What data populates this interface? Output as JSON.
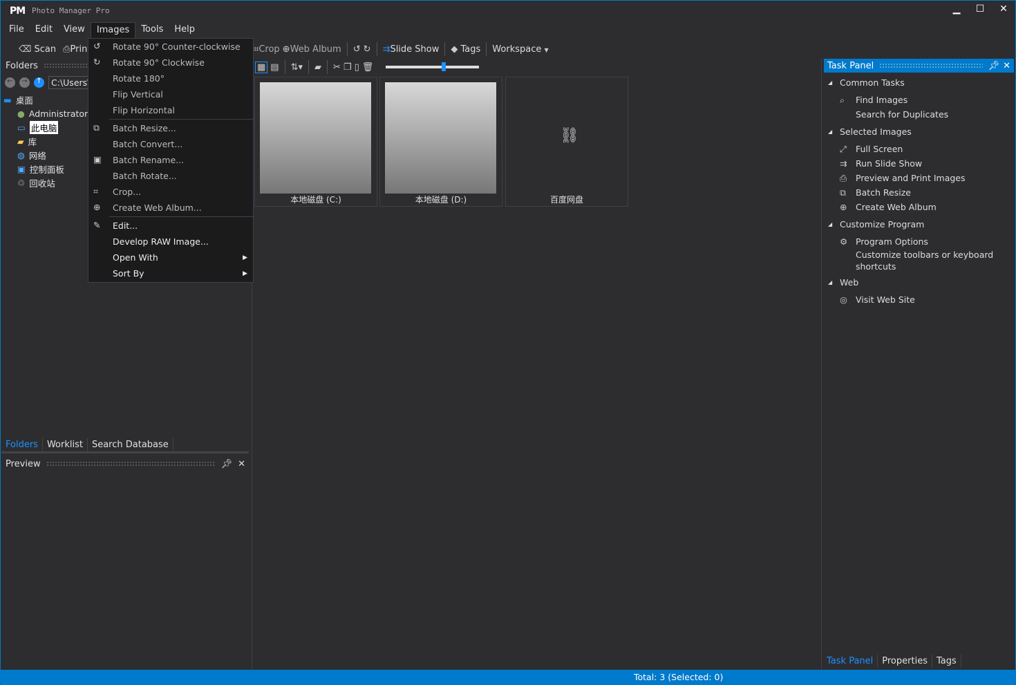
{
  "app": {
    "logo": "PM",
    "title": "Photo Manager Pro"
  },
  "menubar": [
    "File",
    "Edit",
    "View",
    "Images",
    "Tools",
    "Help"
  ],
  "toolbar1": {
    "scan": "Scan",
    "print": "Print",
    "crop": "Crop",
    "web_album": "Web Album",
    "slide_show": "Slide Show",
    "tags": "Tags",
    "workspace": "Workspace"
  },
  "zoom_slider": {
    "value_percent": 60
  },
  "folders": {
    "title": "Folders",
    "path": "C:\\Users\\",
    "tree": [
      "桌面",
      "Administrator",
      "此电脑",
      "库",
      "网络",
      "控制面板",
      "回收站"
    ],
    "selected": "此电脑"
  },
  "left_tabs": [
    "Folders",
    "Worklist",
    "Search Database"
  ],
  "preview": {
    "title": "Preview"
  },
  "images_menu": [
    {
      "label": "Rotate 90° Counter-clockwise",
      "icon": "rotate-ccw-icon"
    },
    {
      "label": "Rotate 90° Clockwise",
      "icon": "rotate-cw-icon"
    },
    {
      "label": "Rotate 180°"
    },
    {
      "label": "Flip Vertical"
    },
    {
      "label": "Flip Horizontal",
      "sep_after": true
    },
    {
      "label": "Batch Resize...",
      "icon": "batch-resize-icon"
    },
    {
      "label": "Batch Convert..."
    },
    {
      "label": "Batch Rename...",
      "icon": "rename-icon"
    },
    {
      "label": "Batch Rotate..."
    },
    {
      "label": "Crop...",
      "icon": "crop-icon"
    },
    {
      "label": "Create Web Album...",
      "icon": "web-album-icon",
      "sep_after": true
    },
    {
      "label": "Edit...",
      "icon": "edit-icon"
    },
    {
      "label": "Develop RAW Image..."
    },
    {
      "label": "Open With",
      "submenu": true
    },
    {
      "label": "Sort By",
      "submenu": true
    }
  ],
  "thumbnails": [
    {
      "label": "本地磁盘 (C:)"
    },
    {
      "label": "本地磁盘 (D:)"
    },
    {
      "label": "百度网盘"
    }
  ],
  "task_panel": {
    "title": "Task Panel",
    "sections": [
      {
        "title": "Common Tasks",
        "items": [
          {
            "label": "Find Images",
            "icon": "find-images-icon"
          },
          {
            "label": "Search for Duplicates"
          }
        ]
      },
      {
        "title": "Selected Images",
        "items": [
          {
            "label": "Full Screen",
            "icon": "fullscreen-icon"
          },
          {
            "label": "Run Slide Show",
            "icon": "slideshow-icon"
          },
          {
            "label": "Preview and Print Images",
            "icon": "printer-icon"
          },
          {
            "label": "Batch Resize",
            "icon": "batch-resize-icon"
          },
          {
            "label": "Create Web Album",
            "icon": "web-album-icon"
          }
        ]
      },
      {
        "title": "Customize Program",
        "items": [
          {
            "label": "Program Options",
            "icon": "gear-icon"
          },
          {
            "label": "Customize toolbars or keyboard shortcuts"
          }
        ]
      },
      {
        "title": "Web",
        "items": [
          {
            "label": "Visit Web Site",
            "icon": "globe-icon"
          }
        ]
      }
    ]
  },
  "right_tabs": [
    "Task Panel",
    "Properties",
    "Tags"
  ],
  "status": "Total: 3 (Selected: 0)",
  "colors": {
    "accent": "#007acc",
    "background": "#2d2d30",
    "menu": "#1b1b1c"
  }
}
